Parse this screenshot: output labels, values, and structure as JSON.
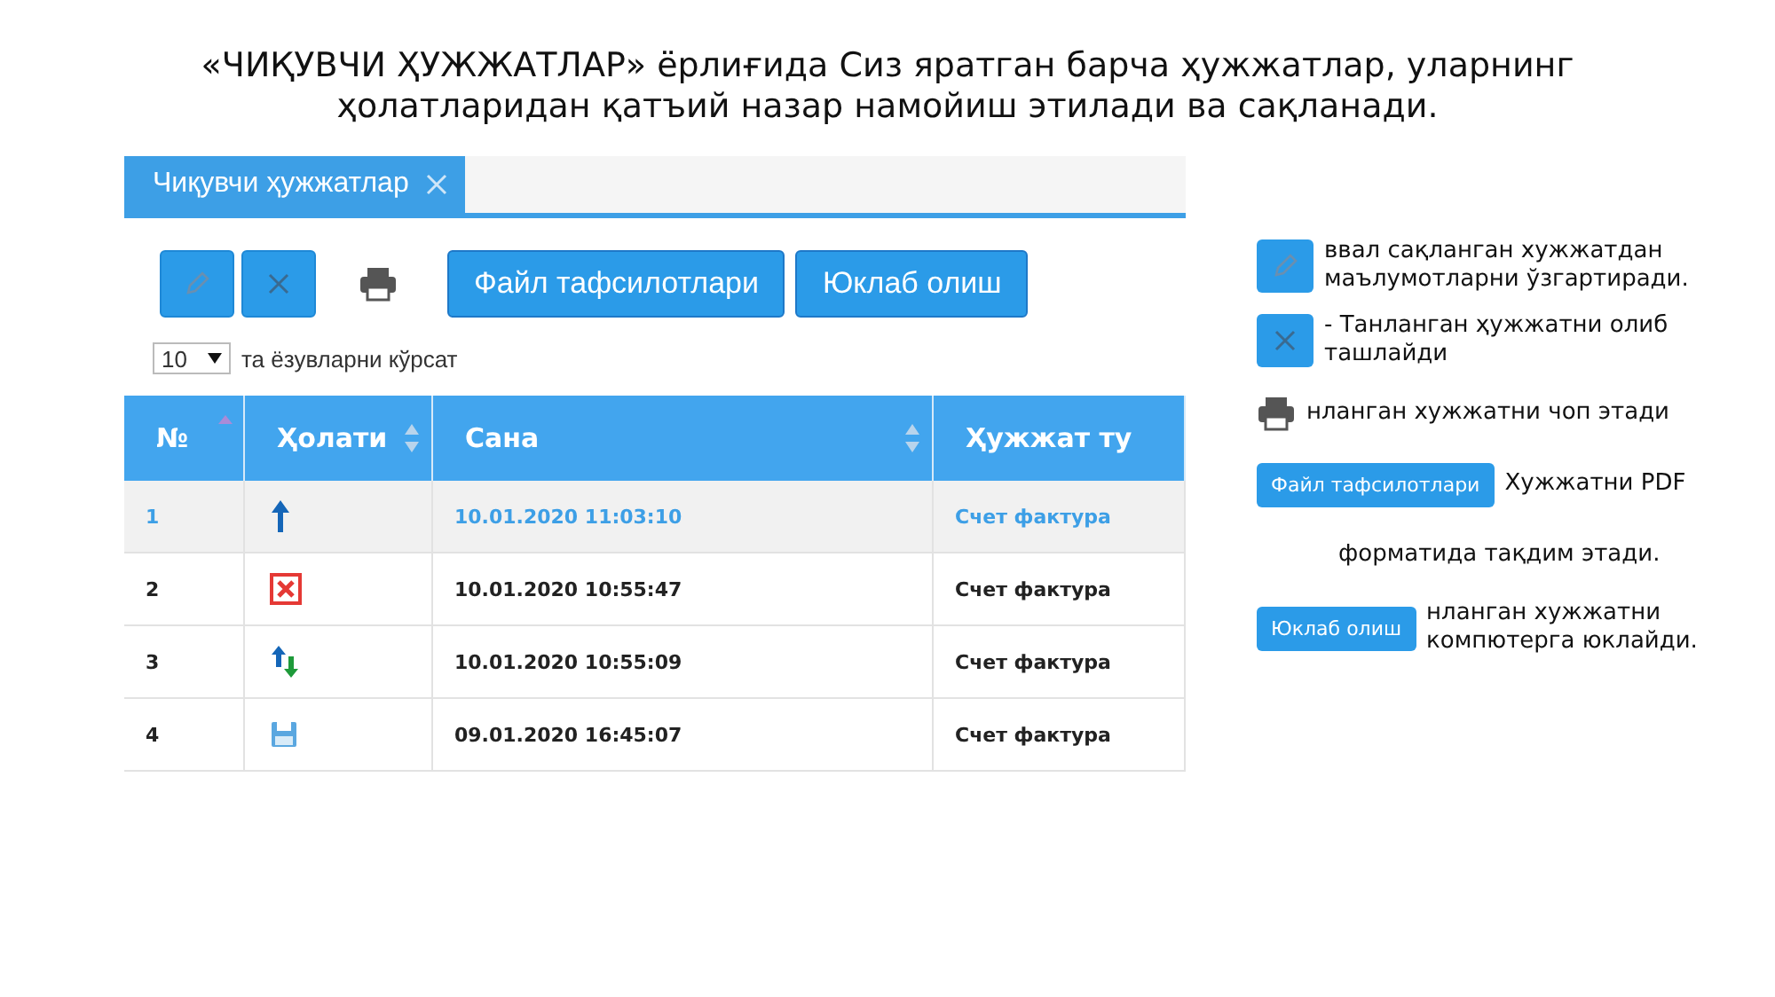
{
  "title": "«ЧИҚУВЧИ ҲУЖЖАТЛАР» ёрлиғида Сиз яратган барча ҳужжатлар, уларнинг ҳолатларидан қатъий назар намойиш этилади ва сақланади.",
  "screenshot": {
    "tab": {
      "label": "Чиқувчи ҳужжатлар",
      "selected": true
    },
    "toolbar": {
      "buttons": [
        "Файл тафсилотлари",
        "Юклаб олиш"
      ]
    },
    "page_size": {
      "value": "10",
      "label": "та ёзувларни кўрсат"
    },
    "table": {
      "columns": [
        {
          "label": "№",
          "kind": "sorted"
        },
        {
          "label": "Ҳолати",
          "kind": "sortable"
        },
        {
          "label": "Сана",
          "kind": "sortable"
        },
        {
          "label": "Ҳужжат ту",
          "kind": "plain"
        }
      ],
      "rows": [
        {
          "number": "1",
          "kind": "sent",
          "date": "10.01.2020 11:03:10",
          "type": "Счет фактура",
          "selected": true
        },
        {
          "number": "2",
          "kind": "rejected",
          "date": "10.01.2020 10:55:47",
          "type": "Счет фактура",
          "selected": false
        },
        {
          "number": "3",
          "kind": "exchange",
          "date": "10.01.2020 10:55:09",
          "type": "Счет фактура",
          "selected": false
        },
        {
          "number": "4",
          "kind": "saved",
          "date": "09.01.2020 16:45:07",
          "type": "Счет фактура",
          "selected": false
        }
      ]
    }
  },
  "legend": [
    {
      "kind": "edit",
      "text": "ввал сақланган хужжатдан маълумотларни ўзгартиради."
    },
    {
      "kind": "delete",
      "text": "- Танланган ҳужжатни олиб ташлайди"
    },
    {
      "kind": "print",
      "text": "нланган хужжатни чоп этади"
    },
    {
      "kind": "button",
      "button": "Файл тафсилотлари",
      "text": "Хужжатни PDF"
    },
    {
      "kind": "note",
      "text": "форматида тақдим этади."
    },
    {
      "kind": "button",
      "button": "Юклаб олиш",
      "text": "нланган хужжатни компютерга юклайди."
    }
  ]
}
